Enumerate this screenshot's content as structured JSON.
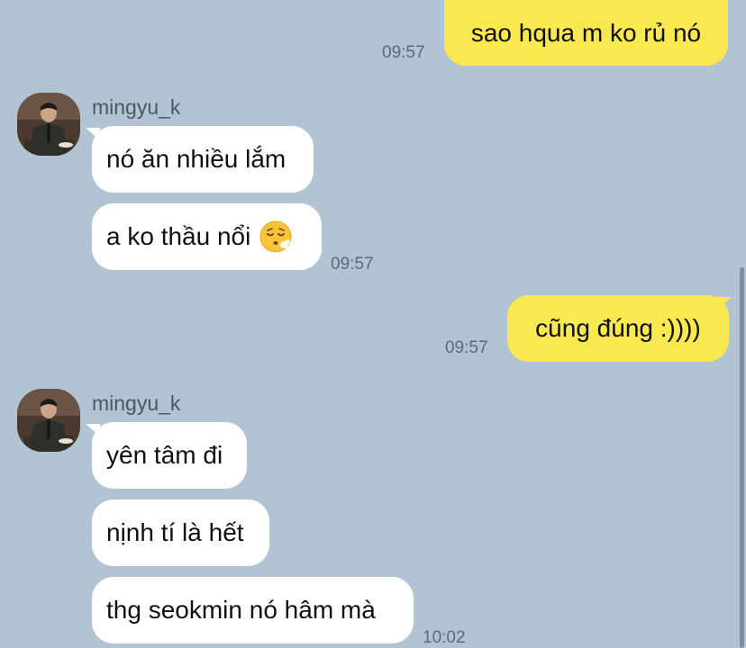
{
  "messages": [
    {
      "sender": "me",
      "text": "sao hqua m ko rủ nó",
      "time": "09:57"
    },
    {
      "sender": "mingyu_k",
      "text": "nó ăn nhiều lắm"
    },
    {
      "sender": "mingyu_k",
      "text": "a ko thầu nổi",
      "emoji": "exhaling-face-icon",
      "time": "09:57"
    },
    {
      "sender": "me",
      "text": "cũng đúng :))))",
      "time": "09:57"
    },
    {
      "sender": "mingyu_k",
      "text": "yên tâm đi"
    },
    {
      "sender": "mingyu_k",
      "text": "nịnh tí là hết"
    },
    {
      "sender": "mingyu_k",
      "text": "thg seokmin nó hâm mà",
      "time": "10:02"
    }
  ],
  "contact": {
    "name": "mingyu_k",
    "avatar_icon": "user-avatar-photo"
  },
  "colors": {
    "background": "#b2c3d3",
    "my_bubble": "#f9e84f",
    "their_bubble": "#ffffff",
    "time_text": "#5d6b78"
  }
}
